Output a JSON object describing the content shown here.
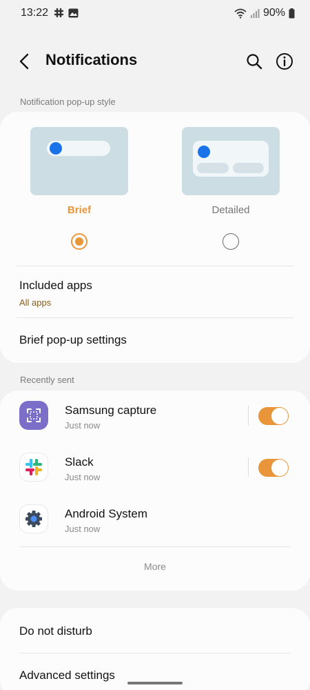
{
  "status_bar": {
    "time": "13:22",
    "left_icons": [
      "slack-icon",
      "image-icon"
    ],
    "battery": "90%",
    "right_icons": [
      "wifi-icon",
      "signal-icon",
      "battery-icon"
    ]
  },
  "header": {
    "title": "Notifications",
    "icons": [
      "back-icon",
      "search-icon",
      "info-icon"
    ]
  },
  "popup_style": {
    "section_label": "Notification pop-up style",
    "options": [
      {
        "label": "Brief",
        "selected": true,
        "color": "#e9953a"
      },
      {
        "label": "Detailed",
        "selected": false,
        "color": "#777777"
      }
    ],
    "included_apps": {
      "title": "Included apps",
      "value": "All apps"
    },
    "brief_settings": "Brief pop-up settings"
  },
  "recent": {
    "section_label": "Recently sent",
    "apps": [
      {
        "name": "Samsung capture",
        "time": "Just now",
        "icon": "samsung-capture-icon",
        "enabled": true
      },
      {
        "name": "Slack",
        "time": "Just now",
        "icon": "slack-icon",
        "enabled": true
      },
      {
        "name": "Android System",
        "time": "Just now",
        "icon": "android-system-gear-icon"
      }
    ],
    "more": "More"
  },
  "settings": {
    "do_not_disturb": "Do not disturb",
    "advanced": "Advanced settings"
  },
  "colors": {
    "accent": "#e9953a",
    "thumb_bg": "#cddde4",
    "dot_blue": "#1a73e8"
  }
}
